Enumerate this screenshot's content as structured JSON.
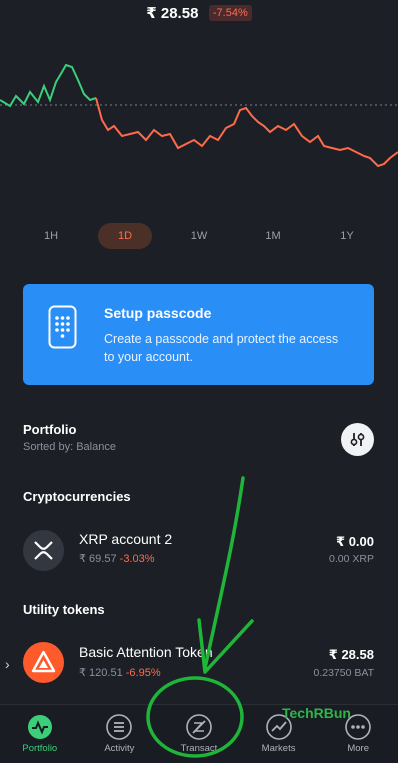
{
  "header": {
    "price": "₹ 28.58",
    "change": "-7.54%"
  },
  "periods": [
    "1H",
    "1D",
    "1W",
    "1M",
    "1Y"
  ],
  "passcode": {
    "title": "Setup passcode",
    "description": "Create a passcode and protect the access to your account."
  },
  "portfolio": {
    "title": "Portfolio",
    "sorted_by": "Sorted by: Balance"
  },
  "crypto": {
    "section": "Cryptocurrencies",
    "name": "XRP account 2",
    "price": "₹ 69.57",
    "change": "-3.03%",
    "value": "₹ 0.00",
    "amount": "0.00 XRP"
  },
  "utility": {
    "section": "Utility tokens",
    "name": "Basic Attention Token",
    "price": "₹ 120.51",
    "change": "-6.95%",
    "value": "₹ 28.58",
    "amount": "0.23750 BAT"
  },
  "nav": {
    "portfolio": "Portfolio",
    "activity": "Activity",
    "transact": "Transact",
    "markets": "Markets",
    "more": "More"
  },
  "watermark": "TechRBun",
  "colors": {
    "accent_green": "#3ccf7a",
    "negative": "#ff6b4a",
    "passcode_blue": "#2a8ef7",
    "annotation_green": "#1fb538"
  }
}
